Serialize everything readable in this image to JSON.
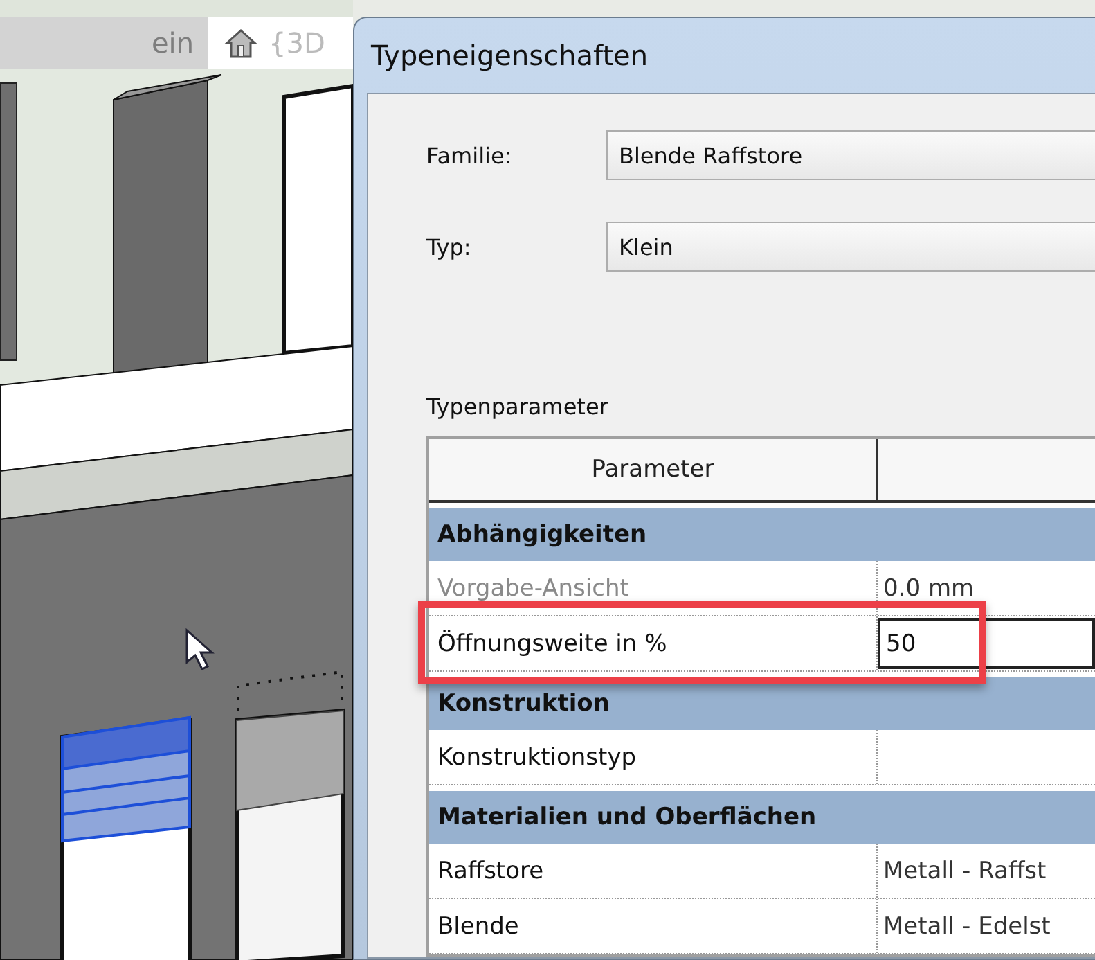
{
  "view_tabs": [
    {
      "label": "ein",
      "selected": false,
      "kind": "plain"
    },
    {
      "label": "{3D",
      "selected": true,
      "kind": "model"
    }
  ],
  "dialog": {
    "title": "Typeneigenschaften",
    "fields": [
      {
        "label": "Familie:",
        "value": "Blende Raffstore"
      },
      {
        "label": "Typ:",
        "value": "Klein"
      }
    ],
    "section_label": "Typenparameter",
    "table": {
      "columns": [
        "Parameter"
      ],
      "rows": [
        {
          "kind": "group",
          "name": "Abhängigkeiten"
        },
        {
          "kind": "param",
          "name": "Vorgabe-Ansicht",
          "value": "0.0 mm",
          "disabled": true,
          "editing": false,
          "highlighted": false
        },
        {
          "kind": "param",
          "name": "Öffnungsweite in %",
          "value": "50",
          "disabled": false,
          "editing": true,
          "highlighted": true
        },
        {
          "kind": "group",
          "name": "Konstruktion"
        },
        {
          "kind": "param",
          "name": "Konstruktionstyp",
          "disabled": false,
          "editing": false,
          "highlighted": false
        },
        {
          "kind": "group",
          "name": "Materialien und Oberflächen"
        },
        {
          "kind": "param",
          "name": "Raffstore",
          "value": "Metall - Raffst",
          "disabled": false,
          "editing": false,
          "highlighted": false
        },
        {
          "kind": "param",
          "name": "Blende",
          "value": "Metall - Edelst",
          "disabled": false,
          "editing": false,
          "highlighted": false
        }
      ]
    }
  }
}
